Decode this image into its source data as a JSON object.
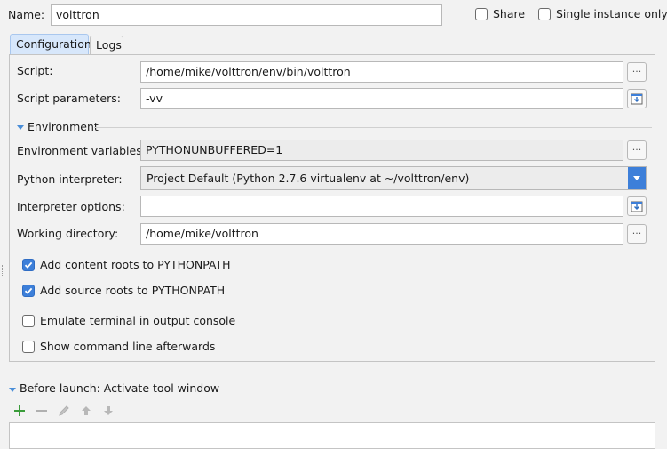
{
  "header": {
    "name_label": "Name:",
    "name_value": "volttron",
    "share_label": "Share",
    "share_checked": false,
    "single_instance_label": "Single instance only",
    "single_instance_checked": false
  },
  "tabs": [
    {
      "label": "Configuration",
      "active": true
    },
    {
      "label": "Logs",
      "active": false
    }
  ],
  "config": {
    "script_label": "Script:",
    "script_value": "/home/mike/volttron/env/bin/volttron",
    "script_params_label": "Script parameters:",
    "script_params_value": "-vv",
    "environment_section": "Environment",
    "env_vars_label": "Environment variables:",
    "env_vars_value": "PYTHONUNBUFFERED=1",
    "interpreter_label": "Python interpreter:",
    "interpreter_value": "Project Default (Python 2.7.6 virtualenv at ~/volttron/env)",
    "interpreter_options_label": "Interpreter options:",
    "interpreter_options_value": "",
    "working_dir_label": "Working directory:",
    "working_dir_value": "/home/mike/volttron",
    "browse_label": "...",
    "options": [
      {
        "label": "Add content roots to PYTHONPATH",
        "checked": true
      },
      {
        "label": "Add source roots to PYTHONPATH",
        "checked": true
      },
      {
        "label": "Emulate terminal in output console",
        "checked": false
      },
      {
        "label": "Show command line afterwards",
        "checked": false
      }
    ]
  },
  "before_launch": {
    "title": "Before launch: Activate tool window",
    "toolbar_icons": [
      "add-icon",
      "remove-icon",
      "edit-icon",
      "move-up-icon",
      "move-down-icon"
    ]
  },
  "colors": {
    "accent": "#3d7fd9",
    "add_green": "#3a9c3a",
    "disabled_gray": "#b0b0b0"
  }
}
